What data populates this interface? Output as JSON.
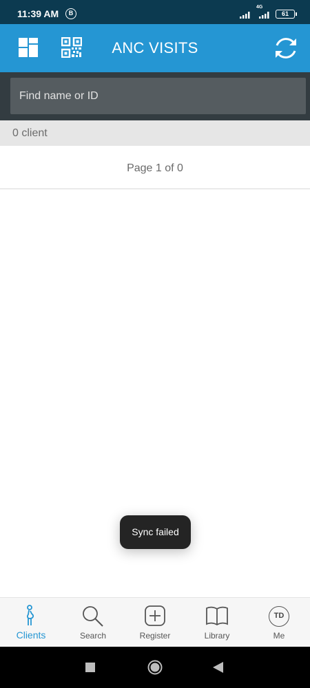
{
  "status_bar": {
    "time": "11:39 AM",
    "b_badge": "B",
    "network": "4G",
    "battery": "61"
  },
  "toolbar": {
    "title": "ANC VISITS",
    "left_icons": [
      "dashboard-icon",
      "qr-code-icon"
    ],
    "right_icon": "sync-icon"
  },
  "search": {
    "placeholder": "Find name or ID"
  },
  "client_count": "0 client",
  "pagination": "Page 1 of 0",
  "toast": "Sync failed",
  "bottom_nav": {
    "items": [
      {
        "label": "Clients",
        "icon": "pregnant-woman-icon",
        "active": true
      },
      {
        "label": "Search",
        "icon": "magnifier-icon",
        "active": false
      },
      {
        "label": "Register",
        "icon": "plus-square-icon",
        "active": false
      },
      {
        "label": "Library",
        "icon": "book-icon",
        "active": false
      },
      {
        "label": "Me",
        "icon": "avatar-icon",
        "initials": "TD",
        "active": false
      }
    ]
  },
  "colors": {
    "toolbar": "#2596d3",
    "status_bar": "#0c3a50",
    "search_strip": "#333c41",
    "accent": "#2596d3"
  }
}
